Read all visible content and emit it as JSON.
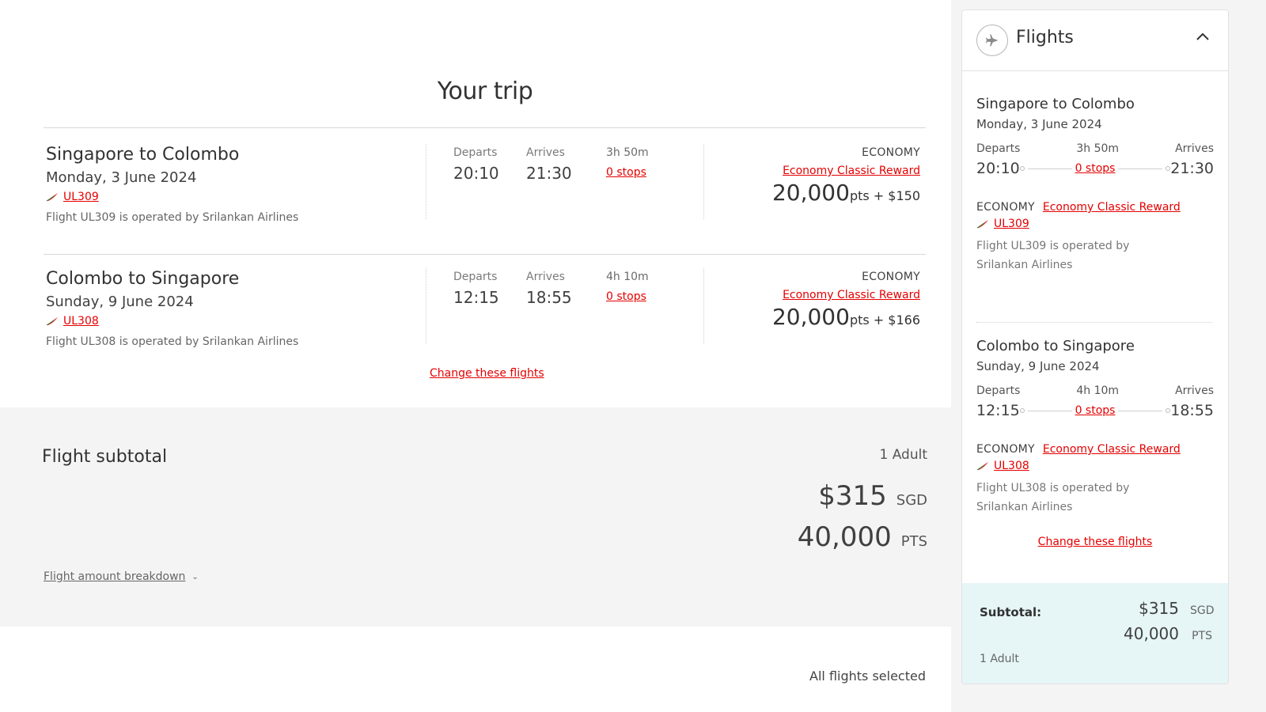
{
  "main": {
    "title": "Your trip",
    "flights": [
      {
        "route": "Singapore to Colombo",
        "date": "Monday, 3 June 2024",
        "flight_no": "UL309",
        "operated_by": "Flight UL309 is operated by Srilankan Airlines",
        "departs_label": "Departs",
        "departs": "20:10",
        "arrives_label": "Arrives",
        "arrives": "21:30",
        "duration": "3h 50m",
        "stops": "0 stops",
        "cabin": "ECONOMY",
        "fare_type": "Economy Classic Reward",
        "points": "20,000",
        "points_suffix": "pts + $150"
      },
      {
        "route": "Colombo to Singapore",
        "date": "Sunday, 9 June 2024",
        "flight_no": "UL308",
        "operated_by": "Flight UL308 is operated by Srilankan Airlines",
        "departs_label": "Departs",
        "departs": "12:15",
        "arrives_label": "Arrives",
        "arrives": "18:55",
        "duration": "4h 10m",
        "stops": "0 stops",
        "cabin": "ECONOMY",
        "fare_type": "Economy Classic Reward",
        "points": "20,000",
        "points_suffix": "pts + $166"
      }
    ],
    "change_flights": "Change these flights",
    "all_selected": "All flights selected"
  },
  "subtotal": {
    "title": "Flight subtotal",
    "passengers": "1 Adult",
    "amount": "$315",
    "currency": "SGD",
    "points": "40,000",
    "points_unit": "PTS",
    "breakdown_link": "Flight amount breakdown"
  },
  "panel": {
    "title": "Flights",
    "icons": {
      "header": "airplane-icon",
      "toggle": "chevron-up-icon"
    },
    "flights": [
      {
        "route": "Singapore to Colombo",
        "date": "Monday, 3 June 2024",
        "departs_label": "Departs",
        "duration": "3h 50m",
        "arrives_label": "Arrives",
        "departs": "20:10",
        "stops": "0 stops",
        "arrives": "21:30",
        "cabin": "ECONOMY",
        "fare_type": "Economy Classic Reward",
        "flight_no": "UL309",
        "operated_by": "Flight UL309 is operated by Srilankan Airlines"
      },
      {
        "route": "Colombo to Singapore",
        "date": "Sunday, 9 June 2024",
        "departs_label": "Departs",
        "duration": "4h 10m",
        "arrives_label": "Arrives",
        "departs": "12:15",
        "stops": "0 stops",
        "arrives": "18:55",
        "cabin": "ECONOMY",
        "fare_type": "Economy Classic Reward",
        "flight_no": "UL308",
        "operated_by": "Flight UL308 is operated by Srilankan Airlines"
      }
    ],
    "change_flights": "Change these flights",
    "subtotal_label": "Subtotal:",
    "subtotal_amount": "$315",
    "subtotal_currency": "SGD",
    "subtotal_points": "40,000",
    "subtotal_points_unit": "PTS",
    "passengers": "1 Adult"
  },
  "colors": {
    "accent_red": "#e40000",
    "subtotal_panel_bg": "#e6f5f6",
    "band_bg": "#f4f4f4"
  }
}
